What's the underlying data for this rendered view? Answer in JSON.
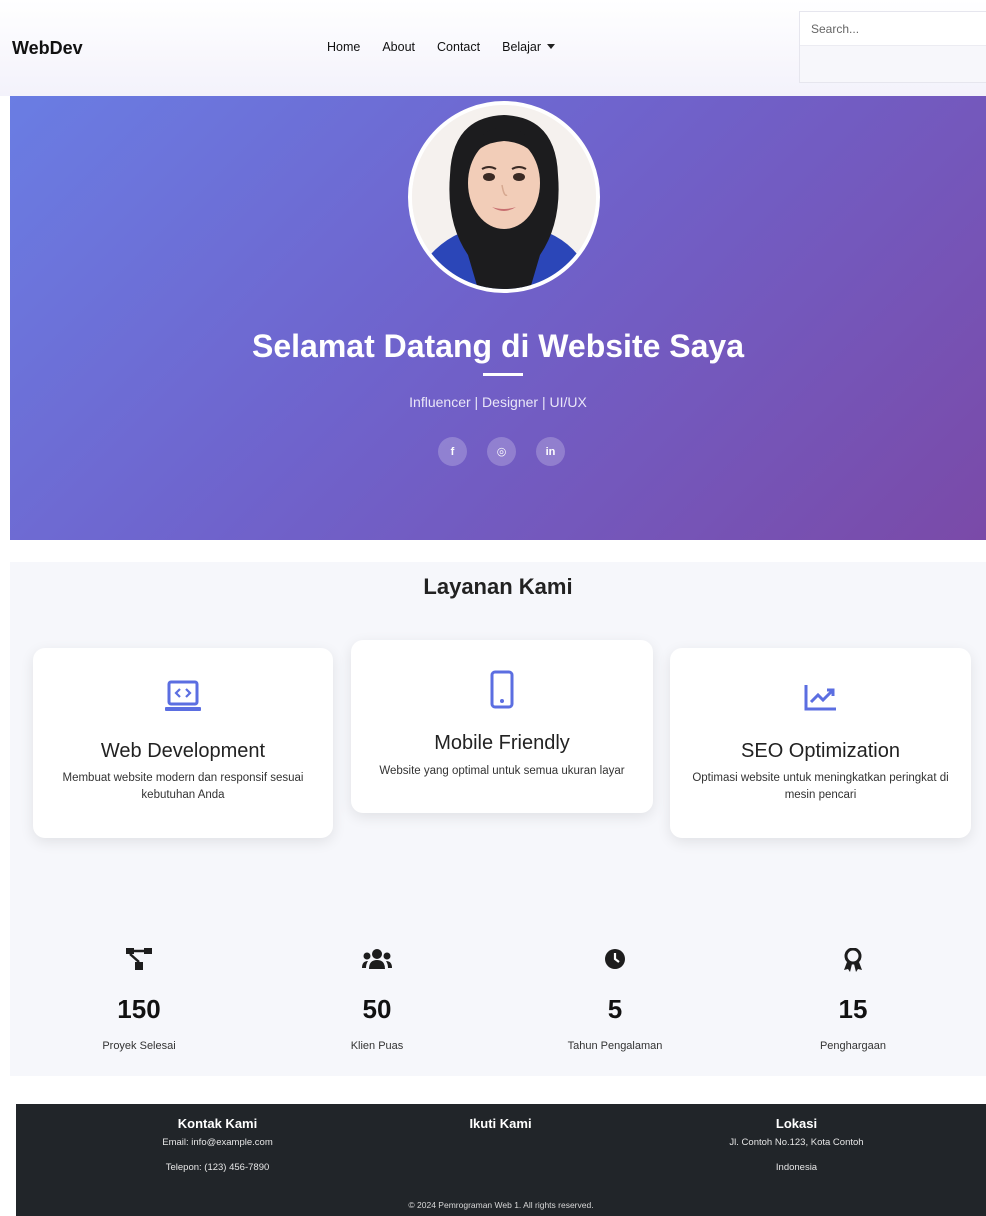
{
  "navbar": {
    "brand": "WebDev",
    "links": [
      "Home",
      "About",
      "Contact",
      "Belajar"
    ],
    "search_placeholder": "Search..."
  },
  "hero": {
    "title": "Selamat Datang di Website Saya",
    "subtitle": "Influencer | Designer | UI/UX",
    "socials": [
      {
        "icon": "facebook-icon",
        "glyph": "f"
      },
      {
        "icon": "instagram-icon",
        "glyph": "◎"
      },
      {
        "icon": "linkedin-icon",
        "glyph": "in"
      }
    ],
    "gradient": [
      "#6a7de3",
      "#7a4aa8"
    ]
  },
  "services": {
    "title": "Layanan Kami",
    "accent_color": "#5b6ee1",
    "cards": [
      {
        "icon": "laptop-code-icon",
        "title": "Web Development",
        "text": "Membuat website modern dan responsif sesuai kebutuhan Anda"
      },
      {
        "icon": "mobile-icon",
        "title": "Mobile Friendly",
        "text": "Website yang optimal untuk semua ukuran layar"
      },
      {
        "icon": "chart-line-icon",
        "title": "SEO Optimization",
        "text": "Optimasi website untuk meningkatkan peringkat di mesin pencari"
      }
    ]
  },
  "stats": [
    {
      "icon": "project-diagram-icon",
      "value": "150",
      "label": "Proyek Selesai"
    },
    {
      "icon": "users-icon",
      "value": "50",
      "label": "Klien Puas"
    },
    {
      "icon": "clock-icon",
      "value": "5",
      "label": "Tahun Pengalaman"
    },
    {
      "icon": "award-icon",
      "value": "15",
      "label": "Penghargaan"
    }
  ],
  "footer": {
    "contact": {
      "title": "Kontak Kami",
      "email": "Email: info@example.com",
      "phone": "Telepon: (123) 456-7890"
    },
    "follow": {
      "title": "Ikuti Kami"
    },
    "location": {
      "title": "Lokasi",
      "address": "Jl. Contoh No.123, Kota Contoh",
      "country": "Indonesia"
    },
    "copyright": "© 2024 Pemrograman Web 1. All rights reserved."
  }
}
